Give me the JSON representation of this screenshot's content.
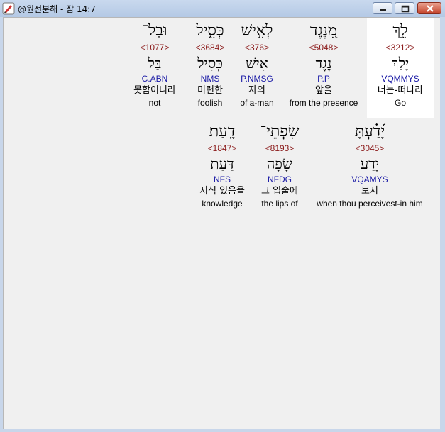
{
  "window": {
    "title": "@원전분해 - 잠 14:7"
  },
  "rows": [
    {
      "words": [
        {
          "hebrew": "לֵ֣ךְ",
          "strong": "<3212>",
          "root": "יָלַךְ",
          "parse": "VQMMYS",
          "korean": "너는-떠나라",
          "english": "Go"
        },
        {
          "hebrew": "מִ֭נֶּגֶד",
          "strong": "<5048>",
          "root": "נֶגֶד",
          "parse": "P.P",
          "korean": "앞을",
          "english": "from the presence"
        },
        {
          "hebrew": "לְאִ֣ישׁ",
          "strong": "<376>",
          "root": "אִישׁ",
          "parse": "P.NMSG",
          "korean": "자의",
          "english": "of a-man"
        },
        {
          "hebrew": "כְּסִ֑יל",
          "strong": "<3684>",
          "root": "כְּסִיל",
          "parse": "NMS",
          "korean": "미련한",
          "english": "foolish"
        },
        {
          "hebrew": "וּבַל־",
          "strong": "<1077>",
          "root": "בַּל",
          "parse": "C.ABN",
          "korean": "못함이니라",
          "english": "not"
        }
      ]
    },
    {
      "words": [
        {
          "hebrew": "יָ֝דַ֗עְתָּ",
          "strong": "<3045>",
          "root": "יָדַע",
          "parse": "VQAMYS",
          "korean": "보지",
          "english": "when thou perceivest-in him"
        },
        {
          "hebrew": "שִׂפְתֵי־",
          "strong": "<8193>",
          "root": "שָׂפָה",
          "parse": "NFDG",
          "korean": "그 입술에",
          "english": "the lips of"
        },
        {
          "hebrew": "דָֽעַת׃",
          "strong": "<1847>",
          "root": "דַּעַת",
          "parse": "NFS",
          "korean": "지식 있음을",
          "english": "knowledge"
        }
      ]
    }
  ]
}
